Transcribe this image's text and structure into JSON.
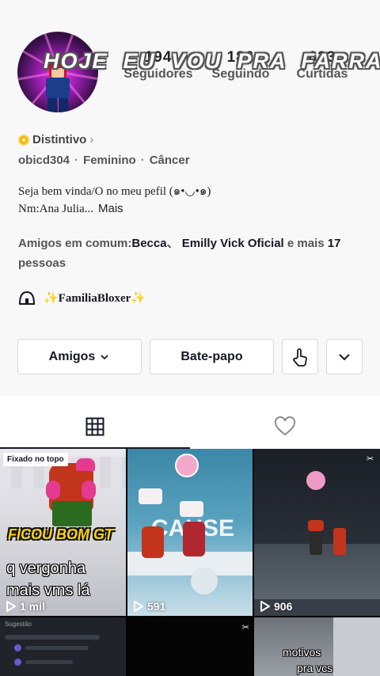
{
  "profile": {
    "stats": [
      {
        "value": "194",
        "label": "Seguidores"
      },
      {
        "value": "186",
        "label": "Seguindo"
      },
      {
        "value": "633",
        "label": "Curtidas"
      }
    ],
    "overlay_text": "HOJE  EU  VOU  PRA  FARRA",
    "badge": "Distintivo",
    "username": "obicd304",
    "gender": "Feminino",
    "sign": "Câncer",
    "bio_line1": "Seja bem vinda/O no meu pefil (๑•◡•๑)",
    "bio_line2": "Nm:Ana Julia...",
    "bio_more": "Mais",
    "friends_prefix": "Amigos em comum:",
    "friend1": "Becca",
    "friend_sep": "、",
    "friend2": "Emilly Vick Oficial",
    "friends_mid": " e mais ",
    "friends_count": "17",
    "friends_suffix": "pessoas",
    "family": "✨FamiliaBloxer✨"
  },
  "actions": {
    "friends_label": "Amigos",
    "chat_label": "Bate-papo"
  },
  "tabs": {
    "videos_icon": "grid-icon",
    "liked_icon": "heart-outline-icon"
  },
  "videos": [
    {
      "views": "1 mil",
      "pinned": "Fixado no topo",
      "caption_top": "FICOU BOM GT",
      "caption_line1": "q vergonha",
      "caption_line2": "mais vms lá"
    },
    {
      "views": "591",
      "sign_text": "CAUSE"
    },
    {
      "views": "906"
    },
    {
      "header": "Sugestão"
    },
    {
      "views": ""
    },
    {
      "caption_line1": "motivos",
      "caption_line2": "pra vcs"
    }
  ],
  "colors": {
    "accent_badge": "#f5b700",
    "text_primary": "#161823",
    "text_secondary": "#555555"
  }
}
